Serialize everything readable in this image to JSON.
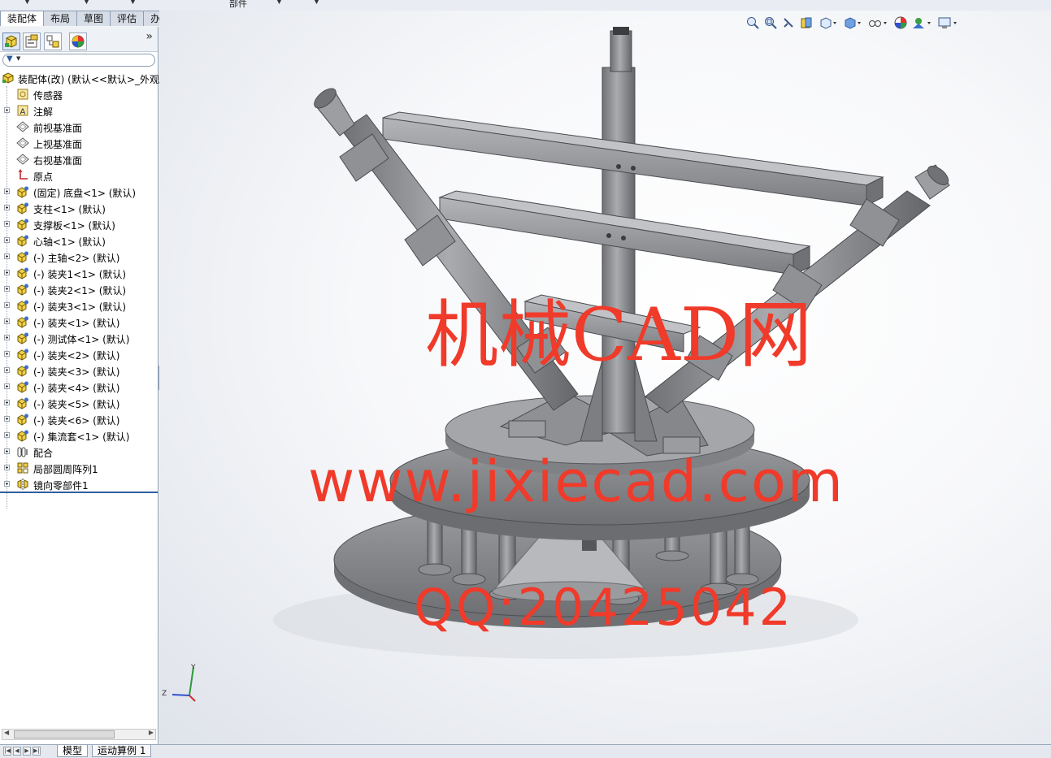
{
  "top_strip": {
    "partial_label": "部件"
  },
  "command_tabs": [
    {
      "label": "装配体",
      "active": true
    },
    {
      "label": "布局",
      "active": false
    },
    {
      "label": "草图",
      "active": false
    },
    {
      "label": "评估",
      "active": false
    },
    {
      "label": "办公室产品",
      "active": false
    }
  ],
  "panel_tabs": {
    "items": [
      "feature-manager-icon",
      "property-manager-icon",
      "configuration-manager-icon",
      "display-manager-icon"
    ],
    "expand_glyph": "»"
  },
  "filter_icon": "filter-icon",
  "tree": {
    "root": "装配体(改)  (默认<<默认>_外观",
    "items": [
      {
        "label": "传感器",
        "icon": "sensor-icon",
        "expandable": false
      },
      {
        "label": "注解",
        "icon": "annotation-icon",
        "expandable": true
      },
      {
        "label": "前视基准面",
        "icon": "plane-icon",
        "expandable": false
      },
      {
        "label": "上视基准面",
        "icon": "plane-icon",
        "expandable": false
      },
      {
        "label": "右视基准面",
        "icon": "plane-icon",
        "expandable": false
      },
      {
        "label": "原点",
        "icon": "origin-icon",
        "expandable": false
      },
      {
        "label": "(固定) 底盘<1> (默认)",
        "icon": "component-icon",
        "expandable": true
      },
      {
        "label": "支柱<1> (默认)",
        "icon": "component-icon",
        "expandable": true
      },
      {
        "label": "支撑板<1> (默认)",
        "icon": "component-icon",
        "expandable": true
      },
      {
        "label": "心轴<1> (默认)",
        "icon": "component-icon",
        "expandable": true
      },
      {
        "label": "(-) 主轴<2> (默认)",
        "icon": "component-icon",
        "expandable": true
      },
      {
        "label": "(-) 装夹1<1> (默认)",
        "icon": "component-icon",
        "expandable": true
      },
      {
        "label": "(-) 装夹2<1> (默认)",
        "icon": "component-icon",
        "expandable": true
      },
      {
        "label": "(-) 装夹3<1> (默认)",
        "icon": "component-icon",
        "expandable": true
      },
      {
        "label": "(-) 装夹<1> (默认)",
        "icon": "component-icon",
        "expandable": true
      },
      {
        "label": "(-) 测试体<1> (默认)",
        "icon": "component-icon",
        "expandable": true
      },
      {
        "label": "(-) 装夹<2> (默认)",
        "icon": "component-icon",
        "expandable": true
      },
      {
        "label": "(-) 装夹<3> (默认)",
        "icon": "component-icon",
        "expandable": true
      },
      {
        "label": "(-) 装夹<4> (默认)",
        "icon": "component-icon",
        "expandable": true
      },
      {
        "label": "(-) 装夹<5> (默认)",
        "icon": "component-icon",
        "expandable": true
      },
      {
        "label": "(-) 装夹<6> (默认)",
        "icon": "component-icon",
        "expandable": true
      },
      {
        "label": "(-) 集流套<1> (默认)",
        "icon": "component-icon",
        "expandable": true
      },
      {
        "label": "配合",
        "icon": "mates-icon",
        "expandable": true
      },
      {
        "label": "局部圆周阵列1",
        "icon": "circular-pattern-icon",
        "expandable": true
      },
      {
        "label": "镜向零部件1",
        "icon": "mirror-component-icon",
        "expandable": true
      }
    ]
  },
  "heads_up_toolbar": [
    "zoom-to-fit-icon",
    "zoom-to-area-icon",
    "previous-view-icon",
    "section-view-icon",
    "view-orientation-icon",
    "display-style-icon",
    "hide-show-items-icon",
    "edit-appearance-icon",
    "apply-scene-icon",
    "view-settings-icon"
  ],
  "watermark": {
    "line1": "机械CAD网",
    "line2": "www.jixiecad.com",
    "line3": "QQ:20425042",
    "color": "#f03a2a"
  },
  "triad": {
    "y": "Y",
    "z": "Z"
  },
  "bottom_tabs": [
    {
      "label": "模型",
      "active": true
    },
    {
      "label": "运动算例 1",
      "active": false
    }
  ],
  "nav_buttons": [
    "first-tab-icon",
    "prev-tab-icon",
    "next-tab-icon",
    "last-tab-icon"
  ],
  "colors": {
    "part_gray": "#8a8c90",
    "part_dark": "#5e6064",
    "part_light": "#a7a9ad",
    "selection_blue": "#2f5f9f"
  }
}
